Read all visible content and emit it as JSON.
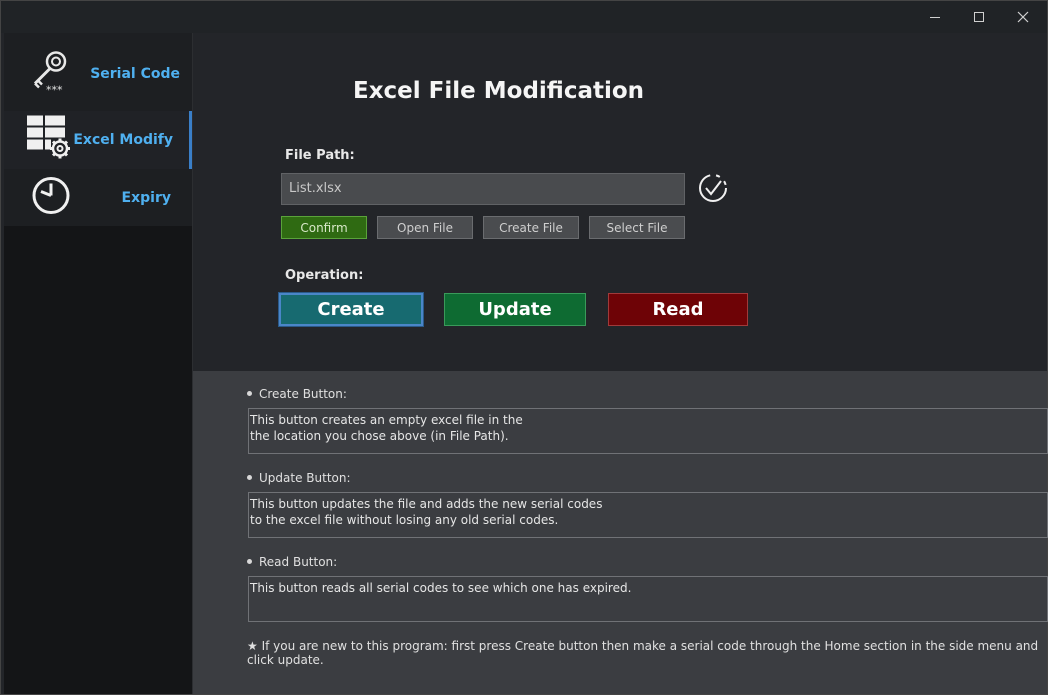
{
  "window": {
    "controls": {
      "minimize": "minimize-icon",
      "maximize": "maximize-icon",
      "close": "close-icon"
    }
  },
  "sidebar": {
    "items": [
      {
        "label": "Serial Code",
        "icon": "key-icon",
        "active": false
      },
      {
        "label": "Excel Modify",
        "icon": "table-gear-icon",
        "active": true
      },
      {
        "label": "Expiry",
        "icon": "clock-icon",
        "active": false
      }
    ],
    "accent_color": "#4fb0f0"
  },
  "main": {
    "title": "Excel File Modification",
    "file_path_label": "File Path:",
    "file_path_value": "List.xlsx",
    "buttons": {
      "confirm": "Confirm",
      "open_file": "Open File",
      "create_file": "Create File",
      "select_file": "Select File"
    },
    "operation_label": "Operation:",
    "operations": {
      "create": {
        "label": "Create",
        "color": "#176a70"
      },
      "update": {
        "label": "Update",
        "color": "#0e6b32"
      },
      "read": {
        "label": "Read",
        "color": "#6e0306"
      }
    }
  },
  "help": {
    "create": {
      "label": "Create Button:",
      "text": "This button creates an empty excel file in the\nthe location you chose above (in File Path)."
    },
    "update": {
      "label": "Update Button:",
      "text": "This button updates the file and adds the new serial codes\nto the excel file without losing any old serial codes."
    },
    "read": {
      "label": "Read Button:",
      "text": "This button reads all serial codes to see which one has expired."
    },
    "footnote": "If you are new to this program: first press Create button then make a serial code through the Home section in the side menu and click update."
  }
}
